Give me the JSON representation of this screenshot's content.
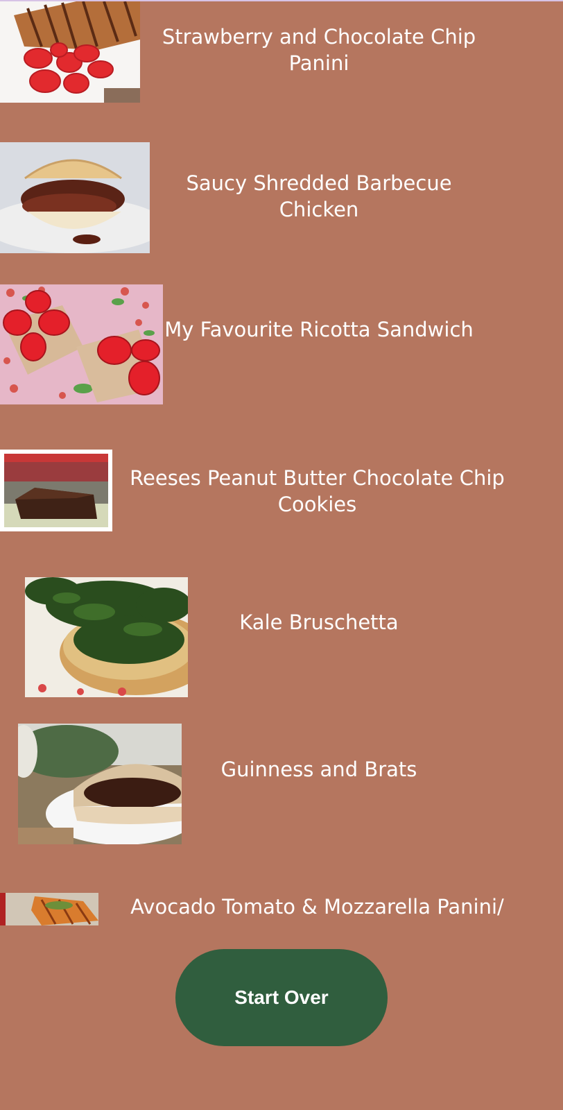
{
  "recipes": [
    {
      "title": "Strawberry and Chocolate Chip Panini",
      "image": "strawberry-panini-photo"
    },
    {
      "title": "Saucy Shredded Barbecue Chicken",
      "image": "bbq-chicken-sandwich-photo"
    },
    {
      "title": "My Favourite Ricotta Sandwich",
      "image": "ricotta-strawberry-toast-photo"
    },
    {
      "title": "Reeses Peanut Butter Chocolate Chip Cookies",
      "image": "chocolate-brownie-photo"
    },
    {
      "title": "Kale Bruschetta",
      "image": "kale-bruschetta-photo"
    },
    {
      "title": "Guinness and Brats",
      "image": "bratwurst-bun-photo"
    },
    {
      "title": "Avocado Tomato & Mozzarella Panini/",
      "image": "panini-photo"
    }
  ],
  "actions": {
    "start_over_label": "Start Over"
  },
  "colors": {
    "background": "#b5765f",
    "button": "#305e3e",
    "text": "#ffffff"
  }
}
